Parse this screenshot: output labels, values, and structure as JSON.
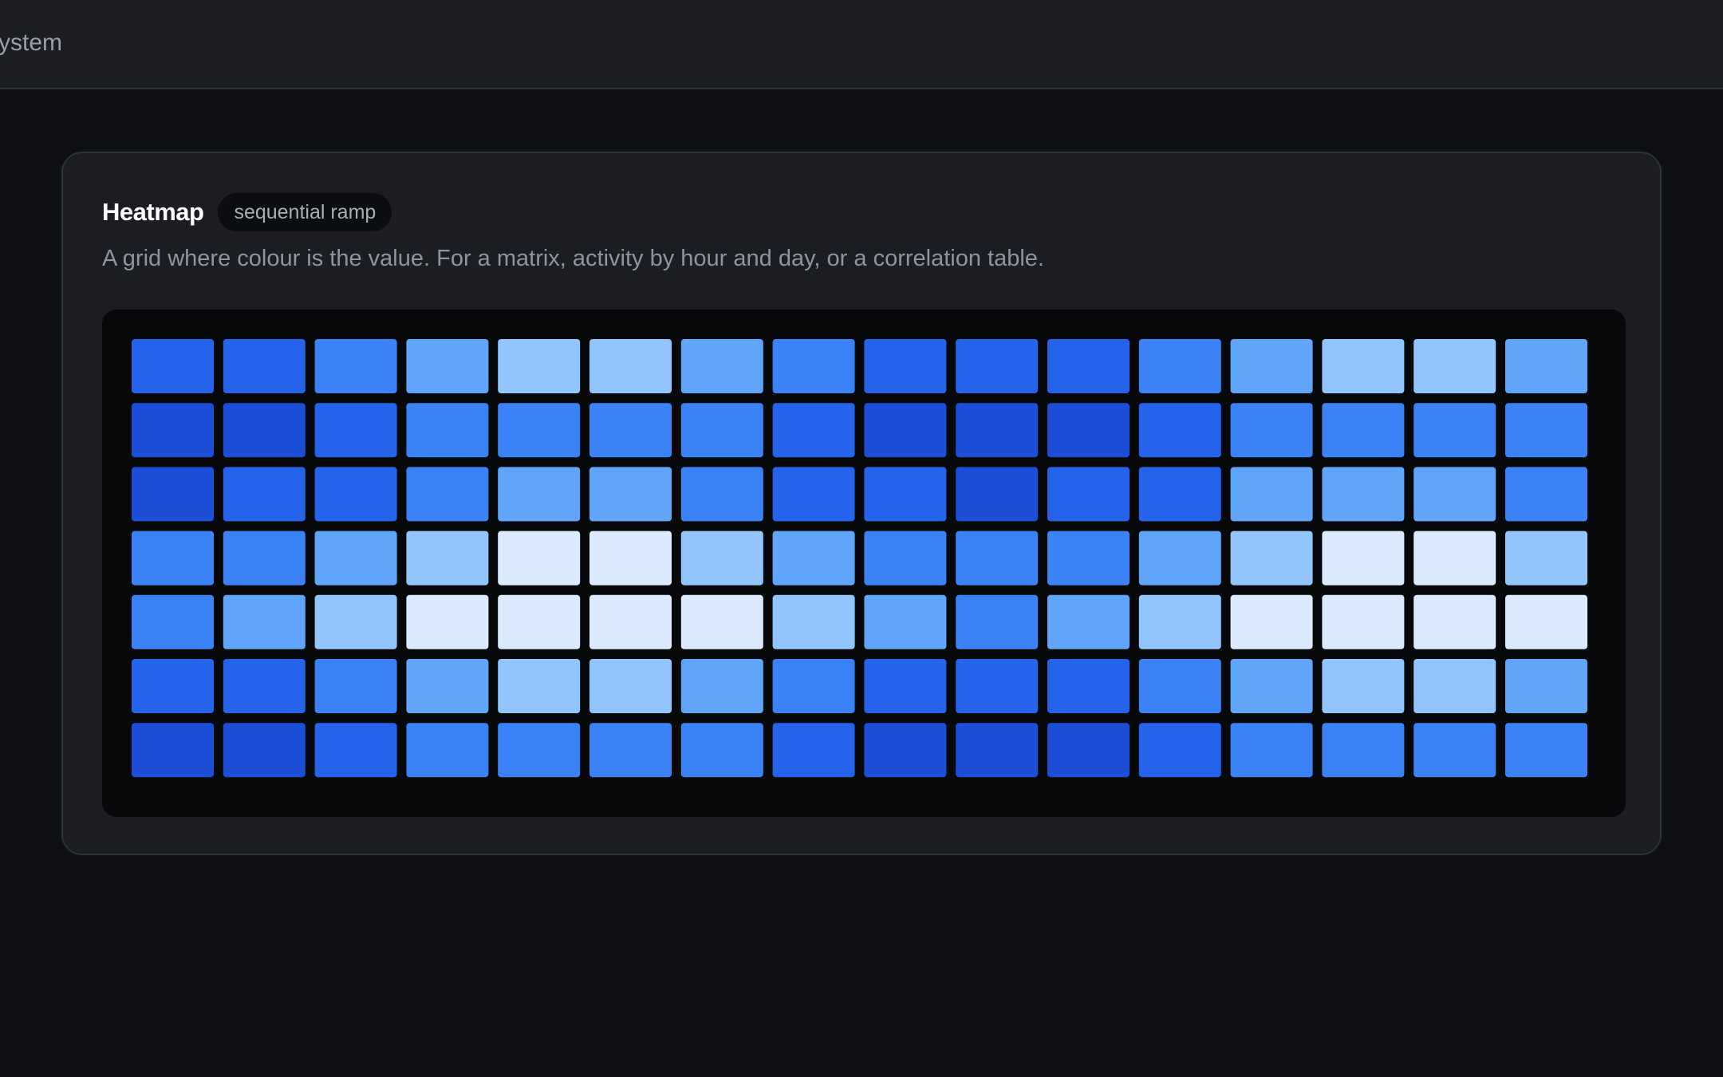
{
  "topbar": {
    "title": "ystem"
  },
  "card": {
    "title": "Heatmap",
    "badge": "sequential ramp",
    "description": "A grid where colour is the value. For a matrix, activity by hour and day, or a correlation table."
  },
  "chart_data": {
    "type": "heatmap",
    "rows": 7,
    "columns": 16,
    "legend": "none",
    "color_scale": [
      "#1d4ed8",
      "#2563eb",
      "#3b82f6",
      "#60a5fa",
      "#93c5fd",
      "#dbeafe"
    ],
    "values": [
      [
        1,
        1,
        2,
        3,
        4,
        4,
        3,
        2,
        1,
        1,
        1,
        2,
        3,
        4,
        4,
        3
      ],
      [
        0,
        0,
        1,
        2,
        2,
        2,
        2,
        1,
        0,
        0,
        0,
        1,
        2,
        2,
        2,
        2
      ],
      [
        0,
        1,
        1,
        2,
        3,
        3,
        2,
        1,
        1,
        0,
        1,
        1,
        3,
        3,
        3,
        2
      ],
      [
        2,
        2,
        3,
        4,
        5,
        5,
        4,
        3,
        2,
        2,
        2,
        3,
        4,
        5,
        5,
        4
      ],
      [
        2,
        3,
        4,
        5,
        5,
        5,
        5,
        4,
        3,
        2,
        3,
        4,
        5,
        5,
        5,
        5
      ],
      [
        1,
        1,
        2,
        3,
        4,
        4,
        3,
        2,
        1,
        1,
        1,
        2,
        3,
        4,
        4,
        3
      ],
      [
        0,
        0,
        1,
        2,
        2,
        2,
        2,
        1,
        0,
        0,
        0,
        1,
        2,
        2,
        2,
        2
      ]
    ]
  }
}
